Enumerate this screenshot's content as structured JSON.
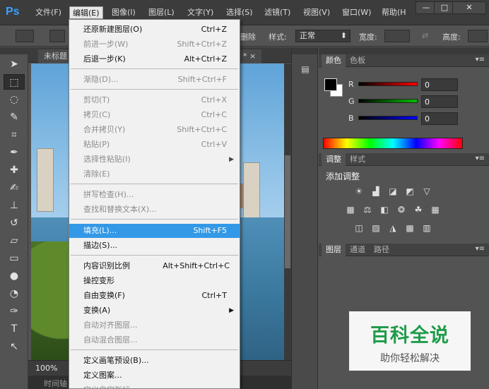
{
  "app": {
    "logo": "Ps",
    "menus": [
      "文件(F)",
      "编辑(E)",
      "图像(I)",
      "图层(L)",
      "文字(Y)",
      "选择(S)",
      "滤镜(T)",
      "视图(V)",
      "窗口(W)",
      "帮助(H"
    ],
    "window_buttons": [
      "—",
      "□",
      "✕"
    ]
  },
  "options": {
    "partial_label": "删除",
    "style_label": "样式:",
    "style_value": "正常",
    "width_label": "宽度:",
    "height_label": "高度:"
  },
  "document": {
    "tab_left": "未标题",
    "tab_right": "* ×",
    "zoom": "100%",
    "timeline_label": "时间轴"
  },
  "edit_menu": [
    {
      "label": "还原新建图层(O)",
      "shortcut": "Ctrl+Z",
      "enabled": true
    },
    {
      "label": "前进一步(W)",
      "shortcut": "Shift+Ctrl+Z",
      "enabled": false
    },
    {
      "label": "后退一步(K)",
      "shortcut": "Alt+Ctrl+Z",
      "enabled": true
    },
    {
      "label": "渐隐(D)...",
      "shortcut": "Shift+Ctrl+F",
      "enabled": false
    },
    {
      "label": "剪切(T)",
      "shortcut": "Ctrl+X",
      "enabled": false
    },
    {
      "label": "拷贝(C)",
      "shortcut": "Ctrl+C",
      "enabled": false
    },
    {
      "label": "合并拷贝(Y)",
      "shortcut": "Shift+Ctrl+C",
      "enabled": false
    },
    {
      "label": "粘贴(P)",
      "shortcut": "Ctrl+V",
      "enabled": false
    },
    {
      "label": "选择性粘贴(I)",
      "shortcut": "",
      "enabled": false,
      "submenu": true
    },
    {
      "label": "清除(E)",
      "shortcut": "",
      "enabled": false
    },
    {
      "label": "拼写检查(H)...",
      "shortcut": "",
      "enabled": false
    },
    {
      "label": "查找和替换文本(X)...",
      "shortcut": "",
      "enabled": false
    },
    {
      "label": "填充(L)...",
      "shortcut": "Shift+F5",
      "enabled": true,
      "highlighted": true
    },
    {
      "label": "描边(S)...",
      "shortcut": "",
      "enabled": true
    },
    {
      "label": "内容识别比例",
      "shortcut": "Alt+Shift+Ctrl+C",
      "enabled": true
    },
    {
      "label": "操控变形",
      "shortcut": "",
      "enabled": true
    },
    {
      "label": "自由变换(F)",
      "shortcut": "Ctrl+T",
      "enabled": true
    },
    {
      "label": "变换(A)",
      "shortcut": "",
      "enabled": true,
      "submenu": true
    },
    {
      "label": "自动对齐图层...",
      "shortcut": "",
      "enabled": false
    },
    {
      "label": "自动混合图层...",
      "shortcut": "",
      "enabled": false
    },
    {
      "label": "定义画笔预设(B)...",
      "shortcut": "",
      "enabled": true
    },
    {
      "label": "定义图案...",
      "shortcut": "",
      "enabled": true
    },
    {
      "label": "定义自定形状...",
      "shortcut": "",
      "enabled": false
    }
  ],
  "color_panel": {
    "tabs": [
      "颜色",
      "色板"
    ],
    "channels": [
      {
        "label": "R",
        "value": "0",
        "color": "#ff0000"
      },
      {
        "label": "G",
        "value": "0",
        "color": "#00c000"
      },
      {
        "label": "B",
        "value": "0",
        "color": "#0000ff"
      }
    ]
  },
  "adjust_panel": {
    "tabs": [
      "调整",
      "样式"
    ],
    "heading": "添加调整"
  },
  "layers_panel": {
    "tabs": [
      "图层",
      "通道",
      "路径"
    ]
  },
  "watermark": {
    "title": "百科全说",
    "subtitle": "助你轻松解决"
  }
}
